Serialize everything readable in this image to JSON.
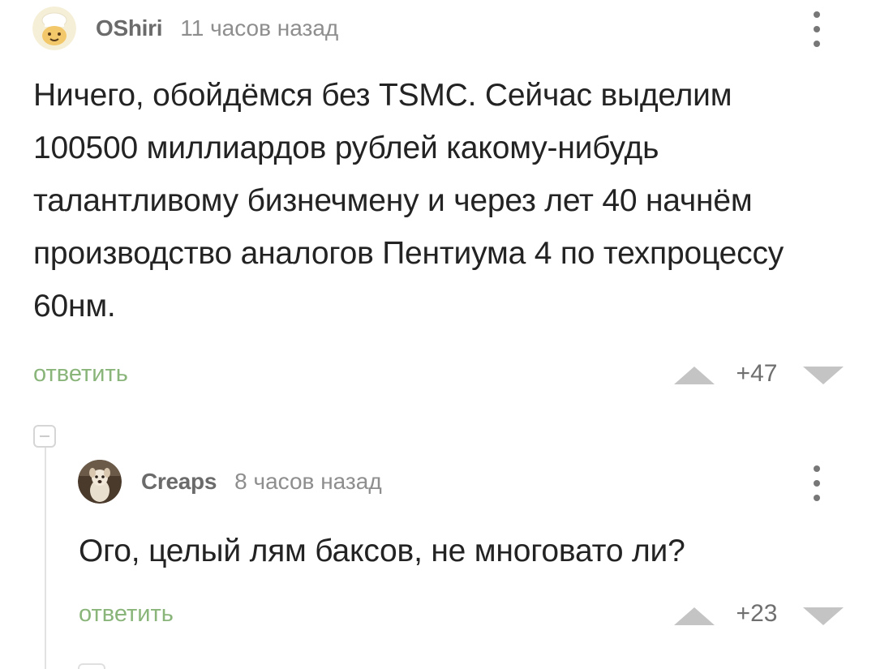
{
  "comments": [
    {
      "author": "OShiri",
      "time": "11 часов назад",
      "avatar_icon": "chef-cookie-avatar",
      "text": "Ничего, обойдёмся без TSMC. Сейчас выделим 100500 миллиардов рублей какому-нибудь талантливому бизнечмену и через лет 40 начнём производство аналогов Пентиума 4 по техпроцессу 60нм.",
      "reply_label": "ответить",
      "score": "+47"
    },
    {
      "author": "Creaps",
      "time": "8 часов назад",
      "avatar_icon": "dog-photo-avatar",
      "text": "Ого, целый лям баксов, не многовато ли?",
      "reply_label": "ответить",
      "score": "+23"
    }
  ],
  "colors": {
    "reply_link": "#8ab57a",
    "author": "#6b6b6b",
    "meta": "#8e8e8e",
    "vote_arrow": "#c4c4c4",
    "thread_line": "#e2e2e2"
  }
}
